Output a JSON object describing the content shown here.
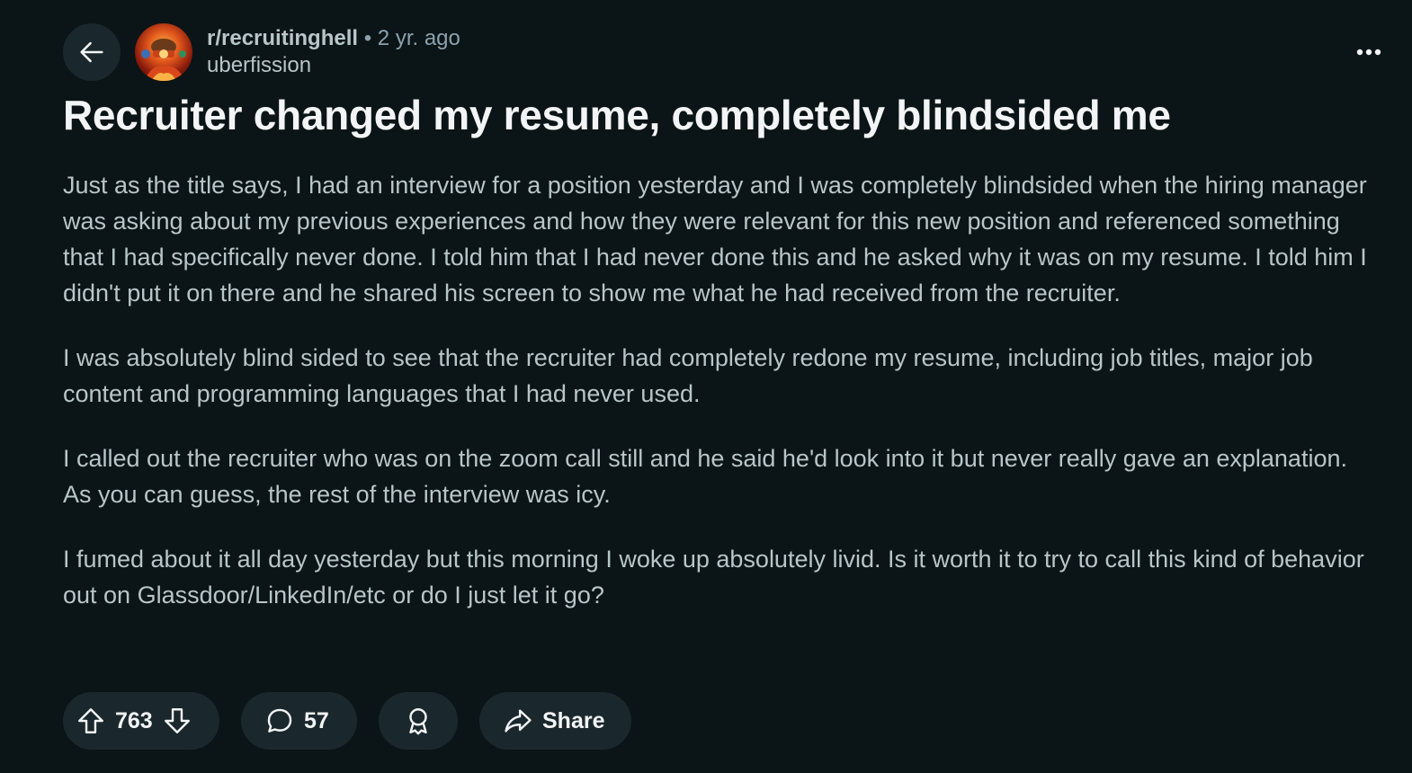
{
  "header": {
    "back_icon": "arrow-left-icon",
    "subreddit": "r/recruitinghell",
    "separator": "•",
    "age": "2 yr. ago",
    "author": "uberfission",
    "more_icon": "more-horizontal-icon"
  },
  "post": {
    "title": "Recruiter changed my resume, completely blindsided me",
    "paragraphs": [
      "Just as the title says, I had an interview for a position yesterday and I was completely blindsided when the hiring manager was asking about my previous experiences and how they were relevant for this new position and referenced something that I had specifically never done. I told him that I had never done this and he asked why it was on my resume. I told him I didn't put it on there and he shared his screen to show me what he had received from the recruiter.",
      "I was absolutely blind sided to see that the recruiter had completely redone my resume, including job titles, major job content and programming languages that I had never used.",
      "I called out the recruiter who was on the zoom call still and he said he'd look into it but never really gave an explanation. As you can guess, the rest of the interview was icy.",
      "I fumed about it all day yesterday but this morning I woke up absolutely livid. Is it worth it to try to call this kind of behavior out on Glassdoor/LinkedIn/etc or do I just let it go?"
    ]
  },
  "actions": {
    "upvote_icon": "upvote-arrow-icon",
    "vote_count": "763",
    "downvote_icon": "downvote-arrow-icon",
    "comment_icon": "comment-bubble-icon",
    "comment_count": "57",
    "award_icon": "award-ribbon-icon",
    "share_icon": "share-arrow-icon",
    "share_label": "Share"
  },
  "colors": {
    "background": "#0b1416",
    "pill_background": "#1a282d",
    "title_text": "#f2f4f5",
    "body_text": "#b8c5c9",
    "meta_text": "#8ba2ad"
  }
}
